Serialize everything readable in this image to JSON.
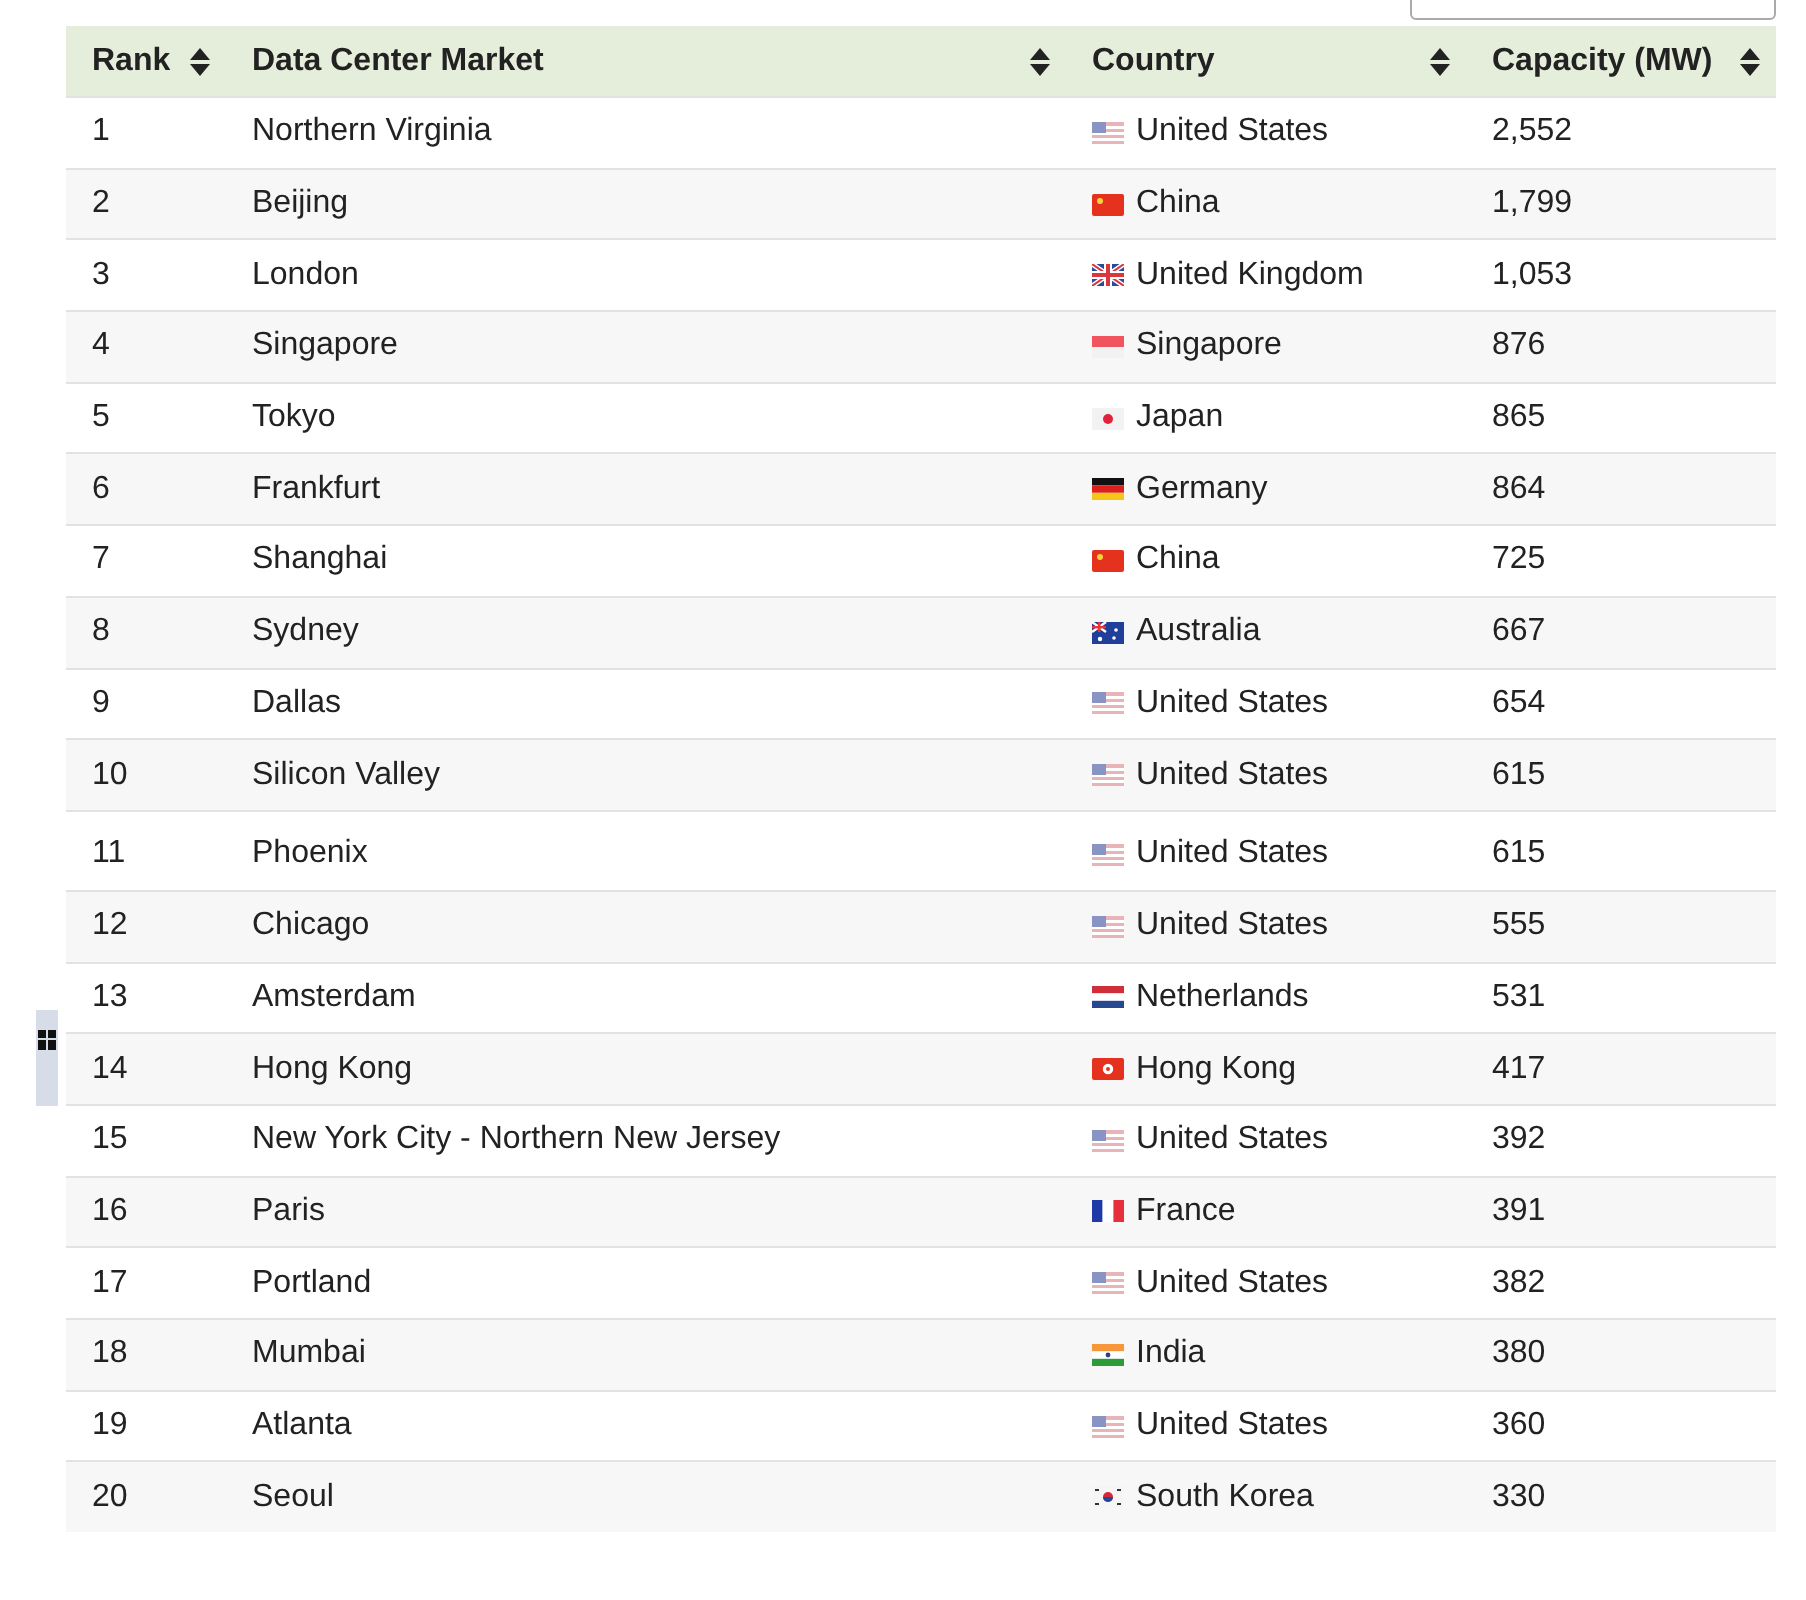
{
  "table": {
    "columns": [
      "Rank",
      "Data Center Market",
      "Country",
      "Capacity (MW)"
    ],
    "rows": [
      {
        "rank": "1",
        "market": "Northern Virginia",
        "country": "United States",
        "kind": "us",
        "capacity": "2,552"
      },
      {
        "rank": "2",
        "market": "Beijing",
        "country": "China",
        "kind": "cn",
        "capacity": "1,799"
      },
      {
        "rank": "3",
        "market": "London",
        "country": "United Kingdom",
        "kind": "gb",
        "capacity": "1,053"
      },
      {
        "rank": "4",
        "market": "Singapore",
        "country": "Singapore",
        "kind": "sg",
        "capacity": "876"
      },
      {
        "rank": "5",
        "market": "Tokyo",
        "country": "Japan",
        "kind": "jp",
        "capacity": "865"
      },
      {
        "rank": "6",
        "market": "Frankfurt",
        "country": "Germany",
        "kind": "de",
        "capacity": "864"
      },
      {
        "rank": "7",
        "market": "Shanghai",
        "country": "China",
        "kind": "cn",
        "capacity": "725"
      },
      {
        "rank": "8",
        "market": "Sydney",
        "country": "Australia",
        "kind": "au",
        "capacity": "667"
      },
      {
        "rank": "9",
        "market": "Dallas",
        "country": "United States",
        "kind": "us",
        "capacity": "654"
      },
      {
        "rank": "10",
        "market": "Silicon Valley",
        "country": "United States",
        "kind": "us",
        "capacity": "615"
      },
      {
        "rank": "11",
        "market": "Phoenix",
        "country": "United States",
        "kind": "us",
        "capacity": "615"
      },
      {
        "rank": "12",
        "market": "Chicago",
        "country": "United States",
        "kind": "us",
        "capacity": "555"
      },
      {
        "rank": "13",
        "market": "Amsterdam",
        "country": "Netherlands",
        "kind": "nl",
        "capacity": "531"
      },
      {
        "rank": "14",
        "market": "Hong Kong",
        "country": "Hong Kong",
        "kind": "hk",
        "capacity": "417"
      },
      {
        "rank": "15",
        "market": "New York City - Northern New Jersey",
        "country": "United States",
        "kind": "us",
        "capacity": "392"
      },
      {
        "rank": "16",
        "market": "Paris",
        "country": "France",
        "kind": "fr",
        "capacity": "391"
      },
      {
        "rank": "17",
        "market": "Portland",
        "country": "United States",
        "kind": "us",
        "capacity": "382"
      },
      {
        "rank": "18",
        "market": "Mumbai",
        "country": "India",
        "kind": "in",
        "capacity": "380"
      },
      {
        "rank": "19",
        "market": "Atlanta",
        "country": "United States",
        "kind": "us",
        "capacity": "360"
      },
      {
        "rank": "20",
        "market": "Seoul",
        "country": "South Korea",
        "kind": "kr",
        "capacity": "330"
      }
    ]
  }
}
